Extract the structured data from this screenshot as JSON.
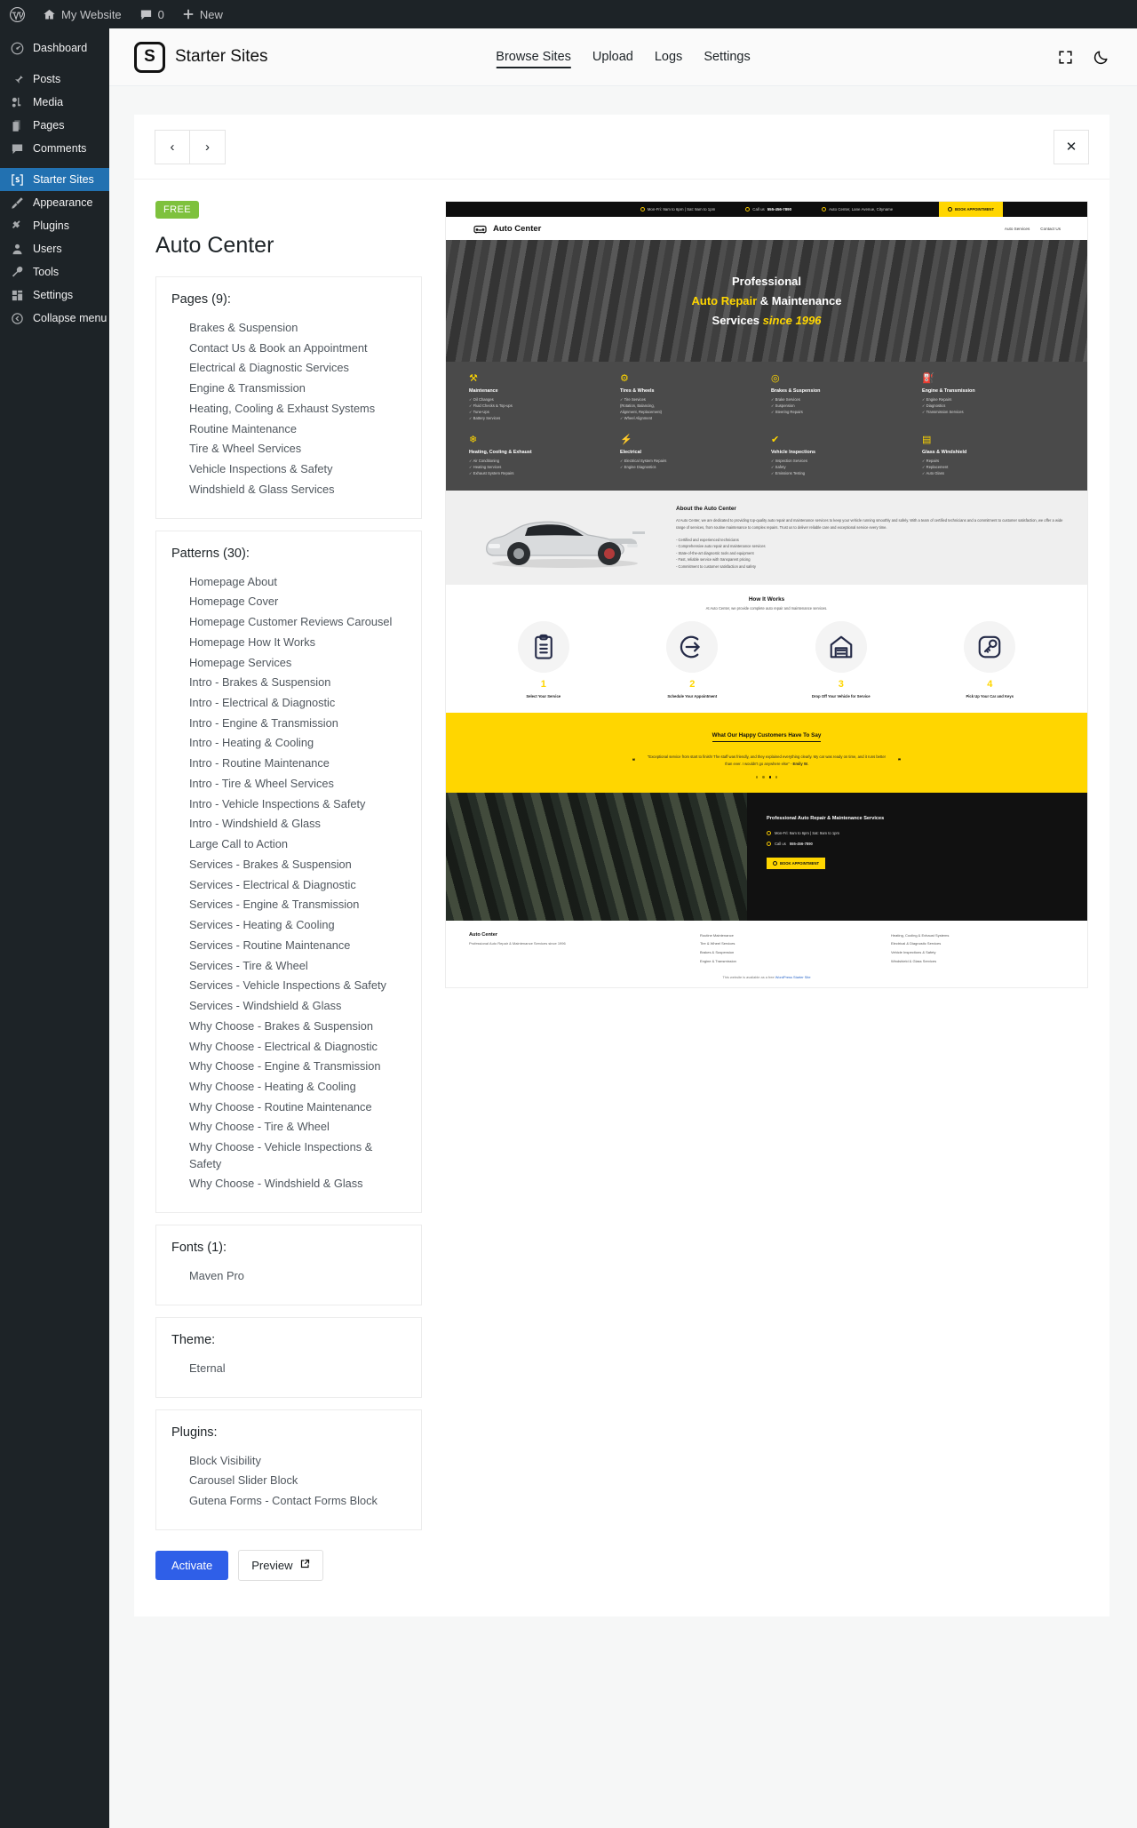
{
  "adminbar": {
    "wp_logo": "wordpress-icon",
    "site_name": "My Website",
    "comment_count": "0",
    "new_label": "New"
  },
  "sidebar": {
    "items": [
      {
        "label": "Dashboard",
        "icon": "dashboard-icon",
        "current": false
      },
      {
        "label": "Posts",
        "icon": "pin-icon",
        "current": false
      },
      {
        "label": "Media",
        "icon": "media-icon",
        "current": false
      },
      {
        "label": "Pages",
        "icon": "pages-icon",
        "current": false
      },
      {
        "label": "Comments",
        "icon": "comment-icon",
        "current": false
      },
      {
        "label": "Starter Sites",
        "icon": "starter-sites-icon",
        "current": true
      },
      {
        "label": "Appearance",
        "icon": "brush-icon",
        "current": false
      },
      {
        "label": "Plugins",
        "icon": "plug-icon",
        "current": false
      },
      {
        "label": "Users",
        "icon": "user-icon",
        "current": false
      },
      {
        "label": "Tools",
        "icon": "wrench-icon",
        "current": false
      },
      {
        "label": "Settings",
        "icon": "settings-icon",
        "current": false
      },
      {
        "label": "Collapse menu",
        "icon": "collapse-icon",
        "current": false
      }
    ]
  },
  "header": {
    "brand_mark": "S",
    "brand_name": "Starter Sites",
    "tabs": [
      {
        "label": "Browse Sites",
        "active": true
      },
      {
        "label": "Upload",
        "active": false
      },
      {
        "label": "Logs",
        "active": false
      },
      {
        "label": "Settings",
        "active": false
      }
    ],
    "fullscreen_icon": "fullscreen-icon",
    "darkmode_icon": "moon-icon"
  },
  "toolbar": {
    "prev_label": "‹",
    "next_label": "›",
    "close_label": "✕"
  },
  "detail": {
    "badge": "FREE",
    "title": "Auto Center",
    "pages": {
      "title": "Pages (9):",
      "items": [
        "Brakes & Suspension",
        "Contact Us & Book an Appointment",
        "Electrical & Diagnostic Services",
        "Engine & Transmission",
        "Heating, Cooling & Exhaust Systems",
        "Routine Maintenance",
        "Tire & Wheel Services",
        "Vehicle Inspections & Safety",
        "Windshield & Glass Services"
      ]
    },
    "patterns": {
      "title": "Patterns (30):",
      "items": [
        "Homepage About",
        "Homepage Cover",
        "Homepage Customer Reviews Carousel",
        "Homepage How It Works",
        "Homepage Services",
        "Intro - Brakes & Suspension",
        "Intro - Electrical & Diagnostic",
        "Intro - Engine & Transmission",
        "Intro - Heating & Cooling",
        "Intro - Routine Maintenance",
        "Intro - Tire & Wheel Services",
        "Intro - Vehicle Inspections & Safety",
        "Intro - Windshield & Glass",
        "Large Call to Action",
        "Services - Brakes & Suspension",
        "Services - Electrical & Diagnostic",
        "Services - Engine & Transmission",
        "Services - Heating & Cooling",
        "Services - Routine Maintenance",
        "Services - Tire & Wheel",
        "Services - Vehicle Inspections & Safety",
        "Services - Windshield & Glass",
        "Why Choose - Brakes & Suspension",
        "Why Choose - Electrical & Diagnostic",
        "Why Choose - Engine & Transmission",
        "Why Choose - Heating & Cooling",
        "Why Choose - Routine Maintenance",
        "Why Choose - Tire & Wheel",
        "Why Choose - Vehicle Inspections & Safety",
        "Why Choose - Windshield & Glass"
      ]
    },
    "fonts": {
      "title": "Fonts (1):",
      "items": [
        "Maven Pro"
      ]
    },
    "theme": {
      "title": "Theme:",
      "items": [
        "Eternal"
      ]
    },
    "plugins": {
      "title": "Plugins:",
      "items": [
        "Block Visibility",
        "Carousel Slider Block",
        "Gutena Forms - Contact Forms Block"
      ]
    },
    "activate_label": "Activate",
    "preview_label": "Preview"
  },
  "preview": {
    "topbar": {
      "hours": "Mon-Fri: 9am to 6pm | Sat: 9am to 1pm",
      "call_prefix": "Call us",
      "phone": "555-456-7890",
      "address": "Auto Center, Lane Avenue, Cityname",
      "book": "BOOK APPOINTMENT"
    },
    "nav": {
      "logo": "Auto Center",
      "links": [
        "Auto Services",
        "Contact Us"
      ]
    },
    "hero": {
      "line1": "Professional",
      "line2_yellow": "Auto Repair",
      "line2_rest": " & Maintenance",
      "line3": "Services ",
      "line3_em": "since 1996"
    },
    "services": [
      {
        "icon": "⚒",
        "title": "Maintenance",
        "items": [
          "Oil Changes",
          "Fluid Checks & Top-ups",
          "Tune-Ups",
          "Battery Services"
        ]
      },
      {
        "icon": "⚙",
        "title": "Tires & Wheels",
        "items": [
          "Tire Services",
          "(Rotation, Balancing,",
          "Alignment, Replacement)",
          "Wheel Alignment"
        ]
      },
      {
        "icon": "◎",
        "title": "Brakes & Suspension",
        "items": [
          "Brake Services",
          "Suspension",
          "Steering Repairs"
        ]
      },
      {
        "icon": "⛽",
        "title": "Engine & Transmission",
        "items": [
          "Engine Repairs",
          "Diagnostics",
          "Transmission Services"
        ]
      },
      {
        "icon": "❄",
        "title": "Heating, Cooling & Exhaust",
        "items": [
          "Air Conditioning",
          "Heating Services",
          "Exhaust System Repairs"
        ]
      },
      {
        "icon": "⚡",
        "title": "Electrical",
        "items": [
          "Electrical System Repairs",
          "Engine Diagnostics"
        ]
      },
      {
        "icon": "✔",
        "title": "Vehicle Inspections",
        "items": [
          "Inspection Services",
          "Safety",
          "Emissions Testing"
        ]
      },
      {
        "icon": "▤",
        "title": "Glass & Windshield",
        "items": [
          "Repairs",
          "Replacement",
          "Auto Glass"
        ]
      }
    ],
    "about": {
      "title": "About the Auto Center",
      "body": "At Auto Center, we are dedicated to providing top-quality auto repair and maintenance services to keep your vehicle running smoothly and safely. With a team of certified technicians and a commitment to customer satisfaction, we offer a wide range of services, from routine maintenance to complex repairs. Trust us to deliver reliable care and exceptional service every time.",
      "bullets": [
        "- Certified and experienced technicians",
        "- Comprehensive auto repair and maintenance services",
        "- State-of-the-art diagnostic tools and equipment",
        "- Fast, reliable service with transparent pricing",
        "- Commitment to customer satisfaction and safety"
      ]
    },
    "how": {
      "title": "How It Works",
      "subtitle": "At Auto Center, we provide complete auto repair and maintenance services.",
      "steps": [
        {
          "num": "1",
          "label": "Select Your Service",
          "icon": "clipboard-icon"
        },
        {
          "num": "2",
          "label": "Schedule Your Appointment",
          "icon": "arrow-circle-icon"
        },
        {
          "num": "3",
          "label": "Drop Off Your Vehicle for Service",
          "icon": "garage-icon"
        },
        {
          "num": "4",
          "label": "Pick Up Your Car and Keys",
          "icon": "key-icon"
        }
      ]
    },
    "reviews": {
      "title": "What Our Happy Customers Have To Say",
      "quote": "\"Exceptional service from start to finish! The staff was friendly, and they explained everything clearly. My car was ready on time, and it runs better than ever. I wouldn't go anywhere else\" -",
      "author": "Emily W."
    },
    "cta": {
      "title": "Professional Auto Repair & Maintenance Services",
      "hours": "Mon-Fri: 9am to 6pm | Sat: 9am to 1pm",
      "call_prefix": "Call us",
      "phone": "555-456-7890",
      "button": "BOOK APPOINTMENT"
    },
    "footer": {
      "brand": "Auto Center",
      "tagline": "Professional Auto Repair & Maintenance Services since 1996",
      "col1": [
        "Routine Maintenance",
        "Tire & Wheel Services",
        "Brakes & Suspension",
        "Engine & Transmission"
      ],
      "col2": [
        "Heating, Cooling & Exhaust Systems",
        "Electrical & Diagnostic Services",
        "Vehicle Inspections & Safety",
        "Windshield & Glass Services"
      ],
      "credit_pre": "This website is available as a free ",
      "credit_link": "WordPress Starter Site"
    }
  }
}
